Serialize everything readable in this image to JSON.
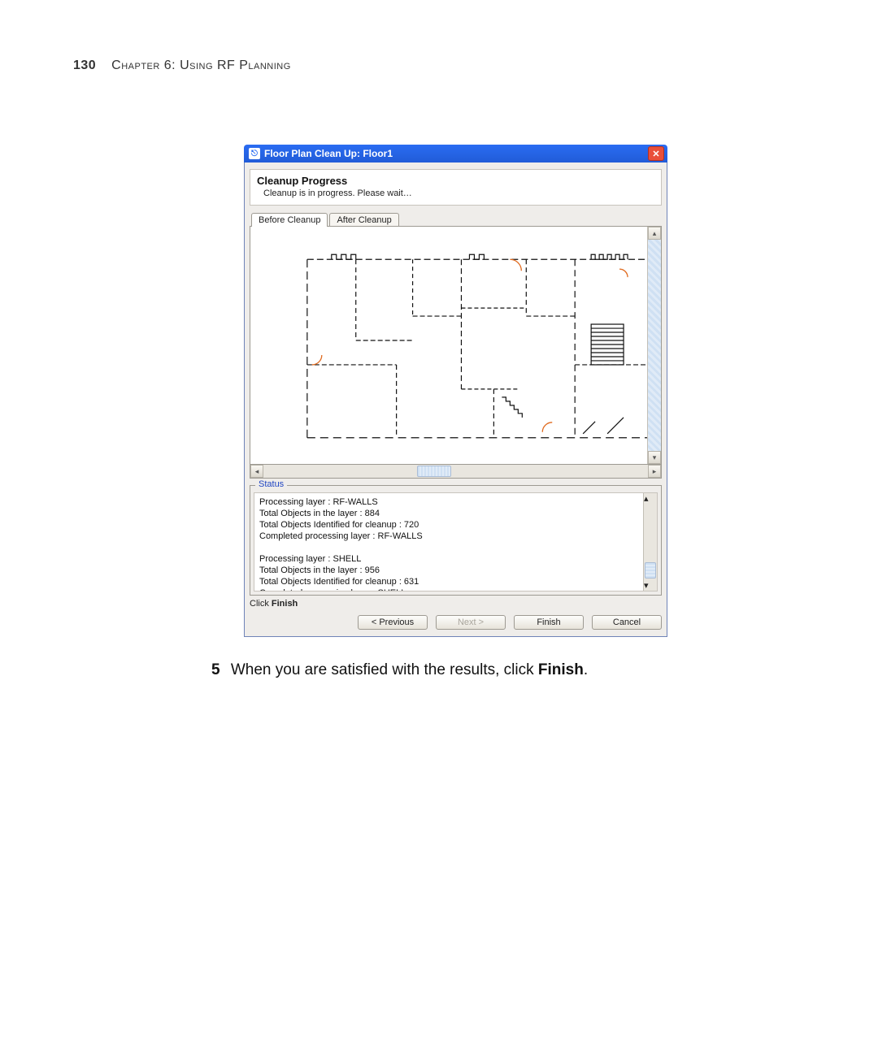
{
  "page_header": {
    "number": "130",
    "chapter": "Chapter 6: Using RF Planning"
  },
  "dialog": {
    "title": "Floor Plan Clean Up: Floor1",
    "heading": "Cleanup Progress",
    "subheading": "Cleanup is in progress. Please wait…",
    "tabs": {
      "before": "Before Cleanup",
      "after": "After Cleanup"
    },
    "status_legend": "Status",
    "status_lines": "Processing layer : RF-WALLS\nTotal Objects in the layer : 884\nTotal Objects Identified for cleanup : 720\nCompleted processing layer : RF-WALLS\n\nProcessing layer : SHELL\nTotal Objects in the layer : 956\nTotal Objects Identified for cleanup : 631\nCompleted processing layer : SHELL",
    "instruction_prefix": "Click ",
    "instruction_bold": "Finish",
    "buttons": {
      "previous": "< Previous",
      "next": "Next >",
      "finish": "Finish",
      "cancel": "Cancel"
    }
  },
  "step": {
    "number": "5",
    "text_before": "When you are satisfied with the results, click ",
    "bold": "Finish",
    "text_after": "."
  }
}
